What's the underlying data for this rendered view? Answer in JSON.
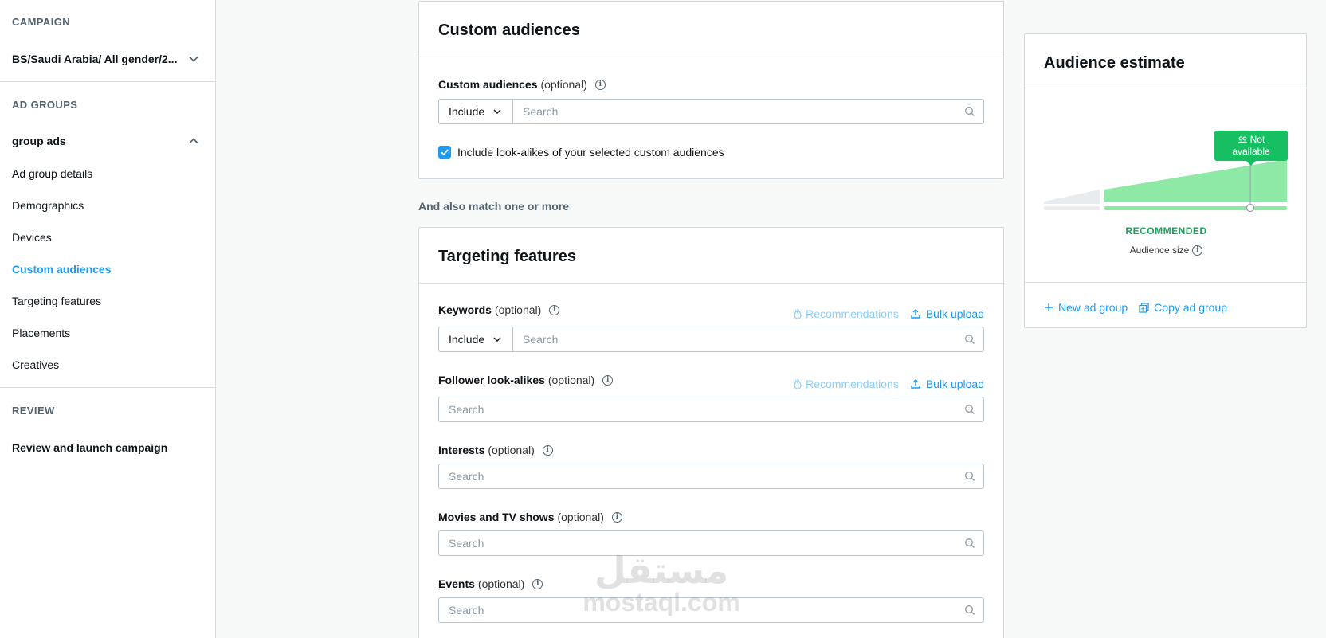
{
  "sidebar": {
    "campaign_label": "CAMPAIGN",
    "campaign_name": "BS/Saudi Arabia/ All gender/2...",
    "ad_groups_label": "AD GROUPS",
    "group_name": "group ads",
    "items": [
      {
        "label": "Ad group details"
      },
      {
        "label": "Demographics"
      },
      {
        "label": "Devices"
      },
      {
        "label": "Custom audiences"
      },
      {
        "label": "Targeting features"
      },
      {
        "label": "Placements"
      },
      {
        "label": "Creatives"
      }
    ],
    "active_item": "Custom audiences",
    "review_label": "REVIEW",
    "review_item": "Review and launch campaign"
  },
  "custom_audiences": {
    "title": "Custom audiences",
    "field_label": "Custom audiences",
    "field_optional": "(optional)",
    "include_label": "Include",
    "search_placeholder": "Search",
    "lookalike_checkbox_label": "Include look-alikes of your selected custom audiences",
    "lookalike_checked": true
  },
  "between_label": "And also match one or more",
  "targeting": {
    "title": "Targeting features",
    "keywords": {
      "label": "Keywords",
      "optional": "(optional)",
      "include_label": "Include",
      "search_placeholder": "Search",
      "recommendations": "Recommendations",
      "bulk_upload": "Bulk upload"
    },
    "follower_lookalikes": {
      "label": "Follower look-alikes",
      "optional": "(optional)",
      "search_placeholder": "Search",
      "recommendations": "Recommendations",
      "bulk_upload": "Bulk upload"
    },
    "interests": {
      "label": "Interests",
      "optional": "(optional)",
      "search_placeholder": "Search"
    },
    "movies_tv": {
      "label": "Movies and TV shows",
      "optional": "(optional)",
      "search_placeholder": "Search"
    },
    "events": {
      "label": "Events",
      "optional": "(optional)",
      "search_placeholder": "Search"
    }
  },
  "audience_estimate": {
    "title": "Audience estimate",
    "badge_line1": "Not",
    "badge_line2": "available",
    "recommended_label": "RECOMMENDED",
    "audience_size_label": "Audience size",
    "new_ad_group": "New ad group",
    "copy_ad_group": "Copy ad group",
    "accent_color": "#17bf63",
    "bar_color": "#8ee8a6"
  },
  "watermark": {
    "arabic": "مستقل",
    "latin": "mostaql.com"
  },
  "colors": {
    "link": "#1d9bf0",
    "muted": "#536471"
  }
}
